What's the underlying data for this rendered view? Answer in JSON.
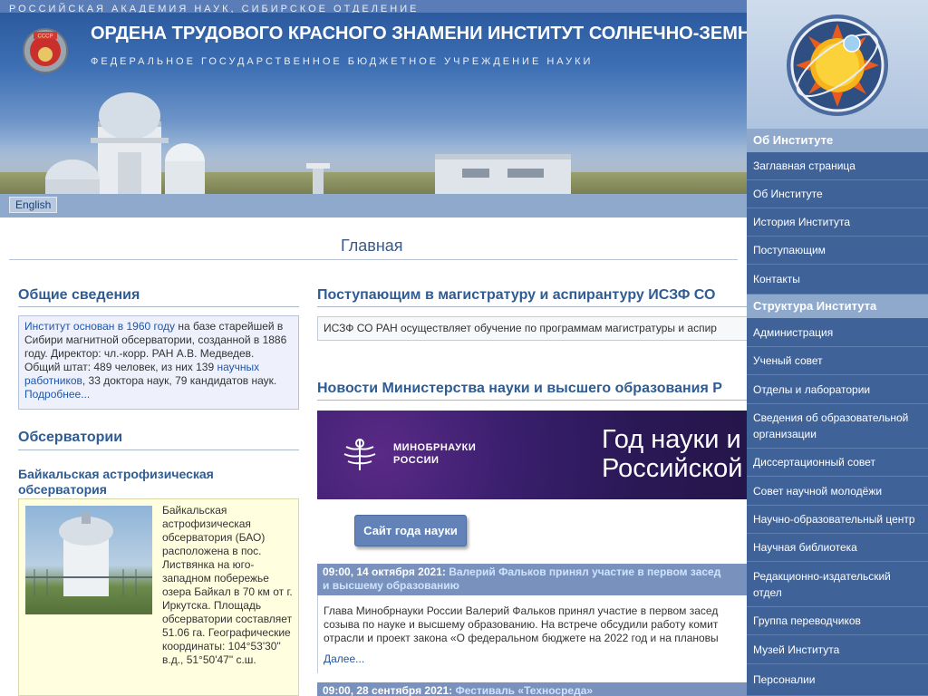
{
  "header": {
    "top_strip": "РОССИЙСКАЯ АКАДЕМИЯ НАУК, СИБИРСКОЕ ОТДЕЛЕНИЕ",
    "title": "ОРДЕНА ТРУДОВОГО КРАСНОГО ЗНАМЕНИ ИНСТИТУТ СОЛНЕЧНО-ЗЕМН",
    "subtitle": "ФЕДЕРАЛЬНОЕ ГОСУДАРСТВЕННОЕ БЮДЖЕТНОЕ УЧРЕЖДЕНИЕ НАУКИ",
    "badge_text": "СССР",
    "lang_button": "English"
  },
  "page_title": "Главная",
  "general": {
    "heading": "Общие сведения",
    "link_founded": "Институт основан в 1960 году",
    "text_1": " на базе старейшей в Сибири магнитной обсерватории, созданной в 1886 году. Директор: чл.-корр. РАН А.В. Медведев. Общий штат: 489 человек, из них 139 ",
    "link_staff": "научных работников",
    "text_2": ", 33 доктора наук, 79 кандидатов наук. ",
    "link_more": "Подробнее..."
  },
  "observatories": {
    "heading": "Обсерватории",
    "baikal_title": "Байкальская астрофизическая обсерватория",
    "baikal_text": "Байкальская астрофизическая обсерватория (БАО) расположена в пос. Листвянка на юго-западном побережье озера Байкал в 70 км от г. Иркутска. Площадь обсерватории составляет 51.06 га. Географические координаты: 104°53'30\" в.д., 51°50'47\" с.ш."
  },
  "admission": {
    "heading": "Поступающим в магистратуру и аспирантуру ИСЗФ СО",
    "text": "ИСЗФ СО РАН осуществляет обучение по программам магистратуры и аспир"
  },
  "ministry": {
    "heading": "Новости Министерства науки и высшего образования Р",
    "banner_org_line1": "МИНОБРНАУКИ",
    "banner_org_line2": "РОССИИ",
    "banner_line1": "Год науки и",
    "banner_line2": "Российской",
    "year_button": "Сайт года науки"
  },
  "news": [
    {
      "time": "09:00, 14 октября 2021:",
      "title": "Валерий Фальков принял участие в первом засед",
      "title_cont": "и высшему образованию",
      "body": "Глава Минобрнауки России Валерий Фальков принял участие в первом засед созыва по науке и высшему образованию. На встрече обсудили работу комит отрасли и проект закона «О федеральном бюджете на 2022 год и на плановы",
      "more": "Далее..."
    },
    {
      "time": "09:00, 28 сентября 2021:",
      "title": "Фестиваль «Техносреда»"
    }
  ],
  "sidebar": {
    "groups": [
      {
        "title": "Об Институте",
        "items": [
          "Заглавная страница",
          "Об Институте",
          "История Института",
          "Поступающим",
          "Контакты"
        ]
      },
      {
        "title": "Структура Института",
        "items": [
          "Администрация",
          "Ученый совет",
          "Отделы и лаборатории",
          "Сведения об образовательной организации",
          "Диссертационный совет",
          "Совет научной молодёжи",
          "Научно-образовательный центр",
          "Научная библиотека",
          "Редакционно-издательский отдел",
          "Группа переводчиков",
          "Музей Института",
          "Персоналии"
        ]
      }
    ]
  },
  "colors": {
    "nav_background": "#3f6399",
    "nav_header": "#8fa9cc",
    "heading_blue": "#2e5c93",
    "link_blue": "#1f56a8",
    "banner_purple": "#2a1855"
  }
}
